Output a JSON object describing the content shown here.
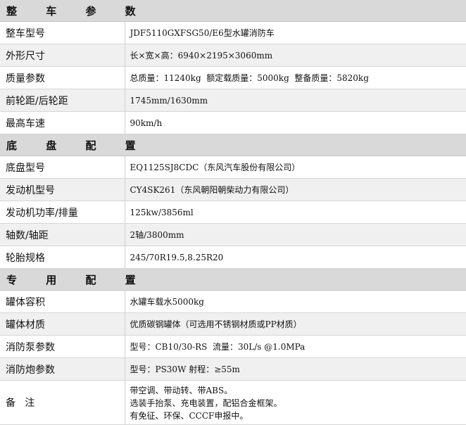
{
  "sections": {
    "vehicle": "整 车 参 数",
    "chassis": "底 盘 配 置",
    "special": "专 用 配 置"
  },
  "vehicle_rows": [
    {
      "label": "整车型号",
      "value": "JDF5110GXFSG50/E6型水罐消防车"
    },
    {
      "label": "外形尺寸",
      "value": "长×宽×高：6940×2195×3060mm"
    },
    {
      "label": "质量参数",
      "value": "总质量：11240kg  额定载质量：5000kg  整备质量：5820kg"
    },
    {
      "label": "前轮距/后轮距",
      "value": "1745mm/1630mm"
    },
    {
      "label": "最高车速",
      "value": "90km/h"
    }
  ],
  "chassis_rows": [
    {
      "label": "底盘型号",
      "value": "EQ1125SJ8CDC（东风汽车股份有限公司）"
    },
    {
      "label": "发动机型号",
      "value": "CY4SK261（东风朝阳朝柴动力有限公司）"
    },
    {
      "label": "发动机功率/排量",
      "value": "125kw/3856ml"
    },
    {
      "label": "轴数/轴距",
      "value": "2轴/3800mm"
    },
    {
      "label": "轮胎规格",
      "value": "245/70R19.5,8.25R20"
    }
  ],
  "special_rows": [
    {
      "label": "罐体容积",
      "value": "水罐车载水5000kg"
    },
    {
      "label": "罐体材质",
      "value": "优质碳钢罐体（可选用不锈钢材质或PP材质）"
    },
    {
      "label": "消防泵参数",
      "value": "型号：CB10/30-RS  流量：30L/s @1.0MPa"
    },
    {
      "label": "消防炮参数",
      "value": "型号：PS30W 射程：≥55m"
    }
  ],
  "notes": {
    "label": "备   注",
    "lines": [
      "带空调、带动转、带ABS。",
      "选装手抬泵、充电装置，配铝合金框架。",
      "有免征、环保、CCCF申报中。"
    ]
  }
}
